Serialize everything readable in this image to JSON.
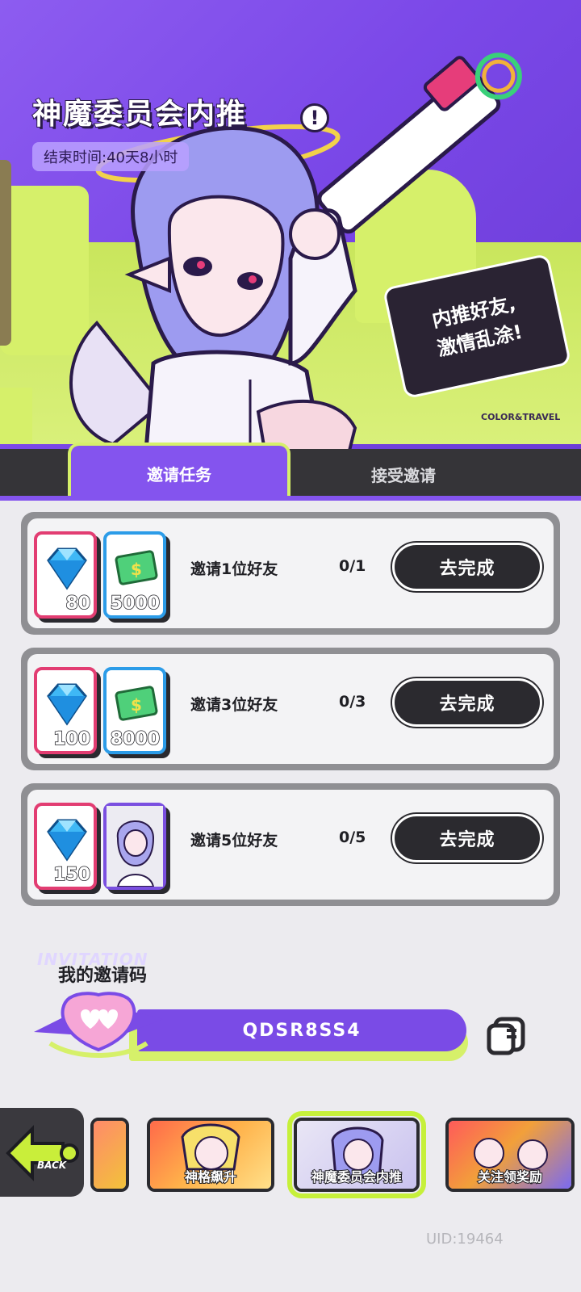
{
  "banner": {
    "title": "神魔委员会内推",
    "info_icon": "exclamation-icon",
    "end_time": "结束时间:40天8小时",
    "speech_line1": "内推好友,",
    "speech_line2": "激情乱涂!",
    "brand": "COLOR&TRAVEL"
  },
  "tabs": [
    {
      "label": "邀请任务",
      "active": true
    },
    {
      "label": "接受邀请",
      "active": false
    }
  ],
  "tasks": [
    {
      "label": "邀请1位好友",
      "progress": "0/1",
      "button": "去完成",
      "rewards": [
        {
          "icon": "diamond-icon",
          "amount": "80"
        },
        {
          "icon": "cash-icon",
          "amount": "5000"
        }
      ]
    },
    {
      "label": "邀请3位好友",
      "progress": "0/3",
      "button": "去完成",
      "rewards": [
        {
          "icon": "diamond-icon",
          "amount": "100"
        },
        {
          "icon": "cash-icon",
          "amount": "8000"
        }
      ]
    },
    {
      "label": "邀请5位好友",
      "progress": "0/5",
      "button": "去完成",
      "rewards": [
        {
          "icon": "diamond-icon",
          "amount": "150"
        },
        {
          "icon": "character-card-icon",
          "amount": ""
        }
      ]
    }
  ],
  "invite": {
    "watermark": "INVITATION",
    "title": "我的邀请码",
    "code": "QDSR8SS4",
    "copy_icon": "copy-icon"
  },
  "bottom_bar": {
    "back_label": "BACK",
    "events": [
      {
        "label": "",
        "selected": false
      },
      {
        "label": "神格飙升",
        "selected": false
      },
      {
        "label": "神魔委员会内推",
        "selected": true
      },
      {
        "label": "关注领奖励",
        "selected": false
      }
    ]
  },
  "uid": "UID:19464",
  "colors": {
    "accent_purple": "#8454ee",
    "accent_lime": "#d6f06a",
    "dark": "#2b2a2f",
    "pink_frame": "#e23d72",
    "blue_frame": "#2c9ce8"
  }
}
